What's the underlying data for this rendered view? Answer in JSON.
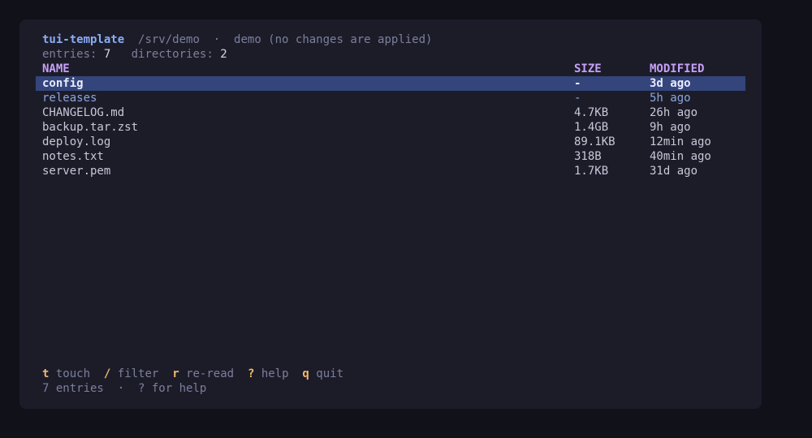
{
  "header": {
    "app_name": "tui-template",
    "path": "/srv/demo",
    "separator": "·",
    "mode": "demo (no changes are applied)"
  },
  "stats": {
    "entries_label": "entries:",
    "entries_value": "7",
    "directories_label": "directories:",
    "directories_value": "2"
  },
  "table": {
    "columns": [
      "NAME",
      "SIZE",
      "MODIFIED"
    ],
    "rows": [
      {
        "name": "config",
        "size": "-",
        "modified": "3d ago",
        "type": "dir",
        "selected": true
      },
      {
        "name": "releases",
        "size": "-",
        "modified": "5h ago",
        "type": "dir",
        "selected": false
      },
      {
        "name": "CHANGELOG.md",
        "size": "4.7KB",
        "modified": "26h ago",
        "type": "file",
        "selected": false
      },
      {
        "name": "backup.tar.zst",
        "size": "1.4GB",
        "modified": "9h ago",
        "type": "file",
        "selected": false
      },
      {
        "name": "deploy.log",
        "size": "89.1KB",
        "modified": "12min ago",
        "type": "file",
        "selected": false
      },
      {
        "name": "notes.txt",
        "size": "318B",
        "modified": "40min ago",
        "type": "file",
        "selected": false
      },
      {
        "name": "server.pem",
        "size": "1.7KB",
        "modified": "31d ago",
        "type": "file",
        "selected": false
      }
    ]
  },
  "keybindings": [
    {
      "key": "t",
      "label": "touch"
    },
    {
      "key": "/",
      "label": "filter"
    },
    {
      "key": "r",
      "label": "re-read"
    },
    {
      "key": "?",
      "label": "help"
    },
    {
      "key": "q",
      "label": "quit"
    }
  ],
  "status": {
    "text": "7 entries  ·  ? for help"
  },
  "colors": {
    "background": "#1c1c29",
    "selection": "#34457c",
    "accent_key": "#f0b86e",
    "header": "#c6a0f6",
    "app_name": "#8aadf4"
  }
}
